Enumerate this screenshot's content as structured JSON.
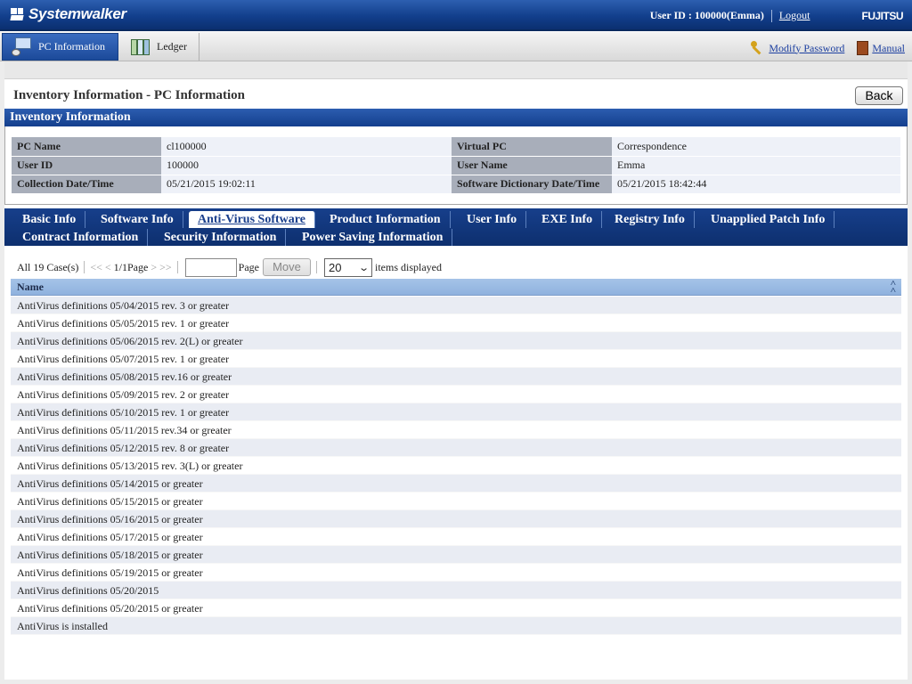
{
  "header": {
    "brand": "Systemwalker",
    "user_id": "User ID : 100000(Emma)",
    "logout": "Logout",
    "vendor": "FUJITSU"
  },
  "menu": {
    "pc_information": "PC Information",
    "ledger": "Ledger",
    "modify_password": "Modify Password",
    "manual": "Manual"
  },
  "page": {
    "title": "Inventory Information - PC Information",
    "back": "Back"
  },
  "inventory": {
    "section_title": "Inventory Information",
    "rows": [
      {
        "label1": "PC Name",
        "value1": "cl100000",
        "label2": "Virtual PC",
        "value2": "Correspondence"
      },
      {
        "label1": "User ID",
        "value1": "100000",
        "label2": "User Name",
        "value2": "Emma"
      },
      {
        "label1": "Collection Date/Time",
        "value1": "05/21/2015 19:02:11",
        "label2": "Software Dictionary Date/Time",
        "value2": "05/21/2015 18:42:44"
      }
    ]
  },
  "tabs": {
    "basic_info": "Basic Info",
    "software_info": "Software Info",
    "antivirus": "Anti-Virus Software",
    "product_info": "Product Information",
    "user_info": "User Info",
    "exe_info": "EXE Info",
    "registry_info": "Registry Info",
    "unapplied_patch": "Unapplied Patch Info",
    "contract_info": "Contract Information",
    "security_info": "Security Information",
    "power_saving": "Power Saving Information"
  },
  "pager": {
    "total": "All 19 Case(s)",
    "first": "<<",
    "prev": "<",
    "page_status": "1/1Page",
    "next": ">",
    "last": ">>",
    "page_label": "Page",
    "move": "Move",
    "items_per_page": "20",
    "items_label": "items displayed"
  },
  "grid": {
    "column_name": "Name",
    "rows": [
      "AntiVirus definitions 05/04/2015 rev. 3 or greater",
      "AntiVirus definitions 05/05/2015 rev. 1 or greater",
      "AntiVirus definitions 05/06/2015 rev. 2(L) or greater",
      "AntiVirus definitions 05/07/2015 rev. 1 or greater",
      "AntiVirus definitions 05/08/2015 rev.16 or greater",
      "AntiVirus definitions 05/09/2015 rev. 2 or greater",
      "AntiVirus definitions 05/10/2015 rev. 1 or greater",
      "AntiVirus definitions 05/11/2015 rev.34 or greater",
      "AntiVirus definitions 05/12/2015 rev. 8 or greater",
      "AntiVirus definitions 05/13/2015 rev. 3(L) or greater",
      "AntiVirus definitions 05/14/2015 or greater",
      "AntiVirus definitions 05/15/2015 or greater",
      "AntiVirus definitions 05/16/2015 or greater",
      "AntiVirus definitions 05/17/2015 or greater",
      "AntiVirus definitions 05/18/2015 or greater",
      "AntiVirus definitions 05/19/2015 or greater",
      "AntiVirus definitions 05/20/2015",
      "AntiVirus definitions 05/20/2015 or greater",
      "AntiVirus is installed"
    ]
  }
}
